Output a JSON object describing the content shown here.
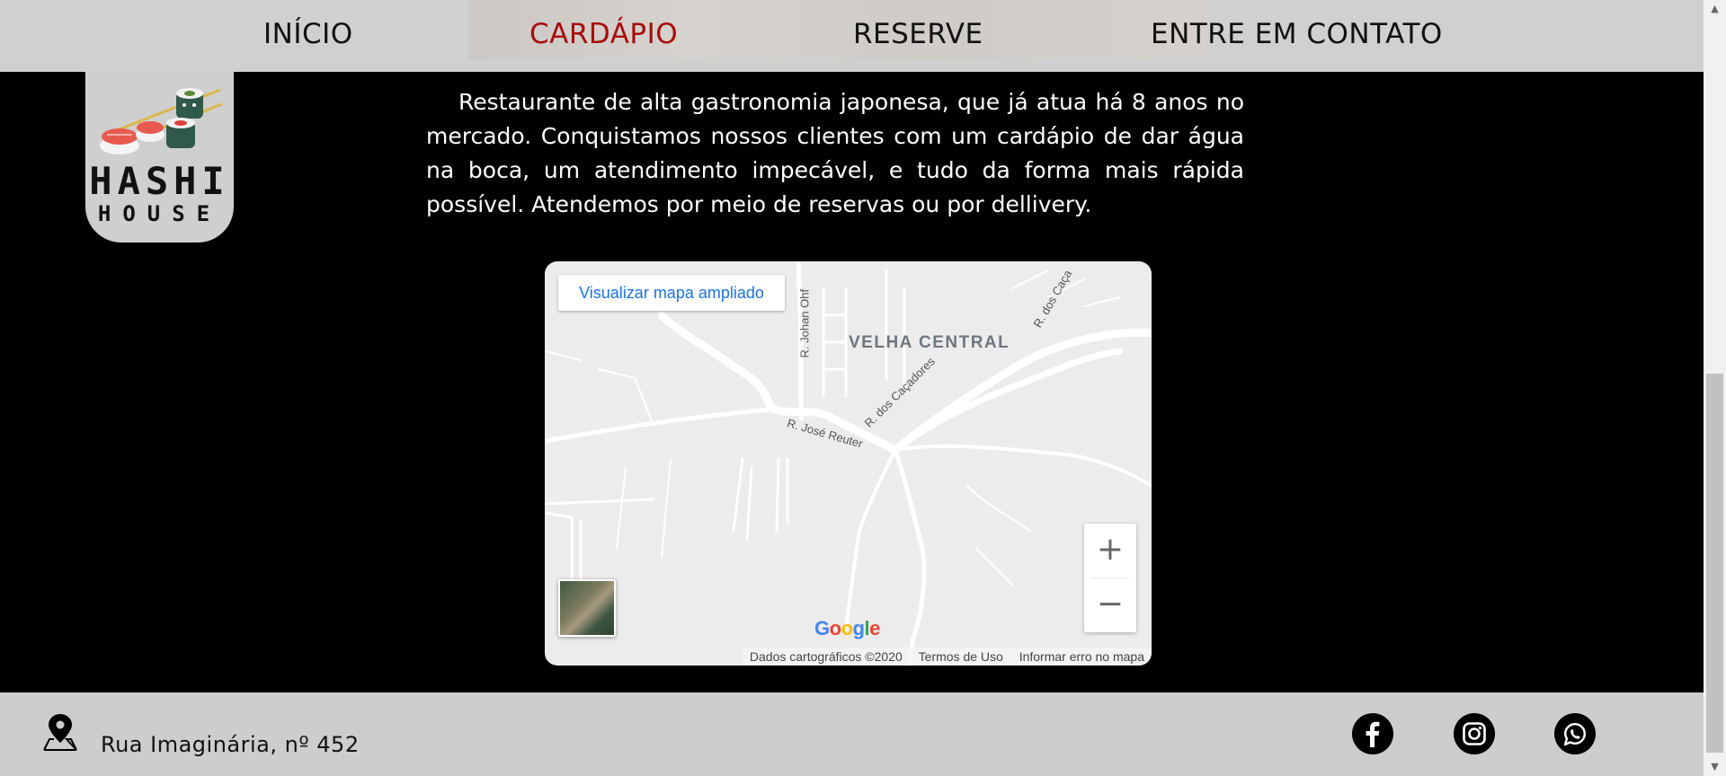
{
  "nav": {
    "items": [
      {
        "label": "INÍCIO",
        "active": false
      },
      {
        "label": "CARDÁPIO",
        "active": true
      },
      {
        "label": "RESERVE",
        "active": false
      },
      {
        "label": "ENTRE EM CONTATO",
        "active": false
      }
    ],
    "active_color": "#a80b0b"
  },
  "logo": {
    "line1": "HASHI",
    "line2": "HOUSE"
  },
  "description": "Restaurante de alta gastronomia japonesa, que já atua há 8 anos no mercado. Conquistamos nossos clientes com um cardápio de dar água na boca, um atendimento impecável, e tudo da forma mais rápida possível. Atendemos por meio de reservas ou por dellivery.",
  "map": {
    "view_larger": "Visualizar mapa ampliado",
    "area_label": "VELHA CENTRAL",
    "streets": [
      "R. Johan Ohf",
      "R. dos Caçadores",
      "R. José Reuter",
      "R. dos Caça"
    ],
    "zoom_in": "+",
    "zoom_out": "−",
    "attribution": {
      "data": "Dados cartográficos ©2020",
      "terms": "Termos de Uso",
      "report": "Informar erro no mapa"
    },
    "google_letters": [
      "G",
      "o",
      "o",
      "g",
      "l",
      "e"
    ],
    "google_colors": [
      "#4285f4",
      "#ea4335",
      "#fbbc05",
      "#4285f4",
      "#34a853",
      "#ea4335"
    ]
  },
  "footer": {
    "address": "Rua Imaginária, nº 452",
    "social": [
      "facebook-icon",
      "instagram-icon",
      "whatsapp-icon"
    ]
  },
  "scrollbar": {
    "up": "▲",
    "down": "▼"
  }
}
